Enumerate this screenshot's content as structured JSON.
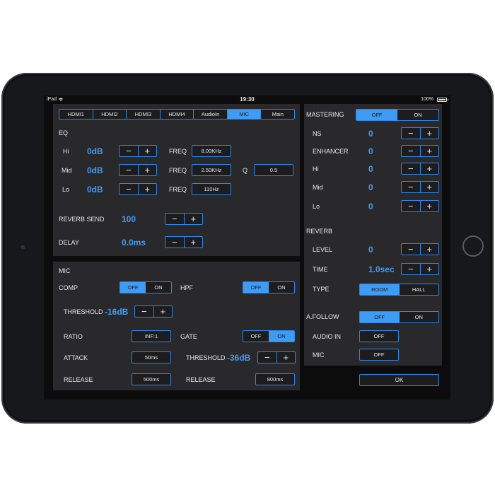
{
  "status": {
    "device": "iPad",
    "time": "19:30",
    "battery": "100%"
  },
  "tabs": [
    "HDMI1",
    "HDMI2",
    "HDMI3",
    "HDMI4",
    "AudioIn",
    "MIC",
    "Main"
  ],
  "active_tab": "MIC",
  "eq": {
    "title": "EQ",
    "hi": {
      "label": "Hi",
      "value": "0dB",
      "freq_label": "FREQ",
      "freq": "8.00KHz"
    },
    "mid": {
      "label": "Mid",
      "value": "0dB",
      "freq_label": "FREQ",
      "freq": "2.50KHz",
      "q_label": "Q",
      "q": "0.5"
    },
    "lo": {
      "label": "Lo",
      "value": "0dB",
      "freq_label": "FREQ",
      "freq": "110Hz"
    }
  },
  "reverb_send": {
    "label": "REVERB SEND",
    "value": "100"
  },
  "delay": {
    "label": "DELAY",
    "value": "0.0ms"
  },
  "mic": {
    "title": "MIC",
    "comp": {
      "label": "COMP",
      "off": "OFF",
      "on": "ON",
      "state": "OFF"
    },
    "hpf": {
      "label": "HPF",
      "off": "OFF",
      "on": "ON",
      "state": "OFF"
    },
    "threshold": {
      "label": "THRESHOLD",
      "value": "-16dB"
    },
    "ratio": {
      "label": "RATIO",
      "value": "INF:1"
    },
    "gate": {
      "label": "GATE",
      "off": "OFF",
      "on": "ON",
      "state": "ON"
    },
    "attack": {
      "label": "ATTACK",
      "value": "50ms"
    },
    "gate_threshold": {
      "label": "THRESHOLD",
      "value": "-36dB"
    },
    "release": {
      "label": "RELEASE",
      "value": "500ms"
    },
    "gate_release": {
      "label": "RELEASE",
      "value": "800ms"
    }
  },
  "mastering": {
    "title": "MASTERING",
    "off": "OFF",
    "on": "ON",
    "state": "OFF",
    "ns": {
      "label": "NS",
      "value": "0"
    },
    "enhancer": {
      "label": "ENHANCER",
      "value": "0"
    },
    "hi": {
      "label": "Hi",
      "value": "0"
    },
    "mid": {
      "label": "Mid",
      "value": "0"
    },
    "lo": {
      "label": "Lo",
      "value": "0"
    }
  },
  "reverb": {
    "title": "REVERB",
    "level": {
      "label": "LEVEL",
      "value": "0"
    },
    "time": {
      "label": "TIME",
      "value": "1.0sec"
    },
    "type": {
      "label": "TYPE",
      "room": "ROOM",
      "hall": "HALL",
      "state": "ROOM"
    }
  },
  "afollow": {
    "label": "A.FOLLOW",
    "off": "OFF",
    "on": "ON",
    "state": "OFF"
  },
  "audio_in": {
    "label": "AUDIO IN",
    "value": "OFF"
  },
  "mic_follow": {
    "label": "MIC",
    "value": "OFF"
  },
  "ok_label": "OK",
  "glyphs": {
    "minus": "−",
    "plus": "+"
  },
  "colors": {
    "accent": "#3f9cf5",
    "panel": "#29292c",
    "background": "#0c0c0d"
  }
}
